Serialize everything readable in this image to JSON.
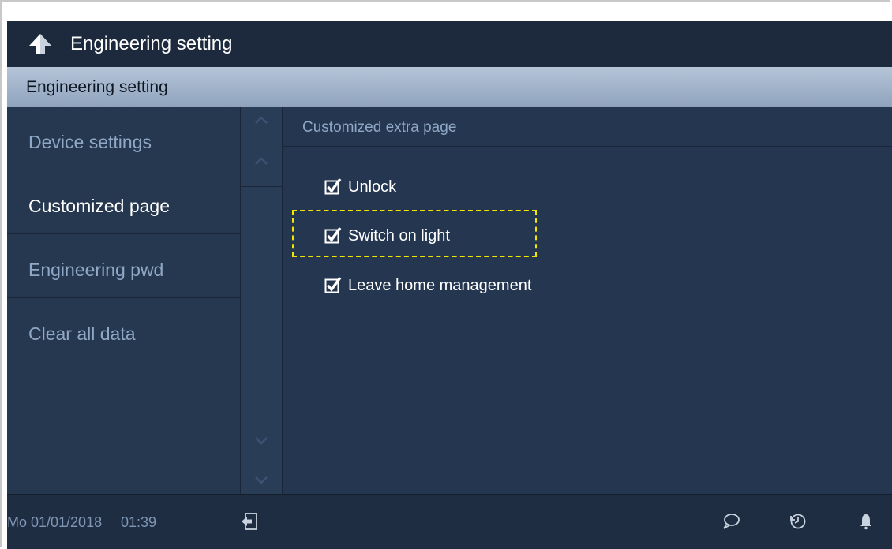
{
  "titlebar": {
    "title": "Engineering setting",
    "back_icon": "back-arrow-icon"
  },
  "subheader": {
    "title": "Engineering setting"
  },
  "sidebar": {
    "items": [
      {
        "label": "Device settings",
        "active": false
      },
      {
        "label": "Customized page",
        "active": true
      },
      {
        "label": "Engineering pwd",
        "active": false
      },
      {
        "label": "Clear all data",
        "active": false
      }
    ]
  },
  "content": {
    "heading": "Customized extra page",
    "options": [
      {
        "label": "Unlock",
        "checked": true
      },
      {
        "label": "Switch on light",
        "checked": true
      },
      {
        "label": "Leave home management",
        "checked": true
      }
    ]
  },
  "footer": {
    "date": "Mo 01/01/2018",
    "time": "01:39",
    "icons": [
      "exit-icon",
      "message-icon",
      "history-icon",
      "bell-icon"
    ]
  },
  "colors": {
    "titlebar_bg": "#1d2a3d",
    "panel_bg": "#253650",
    "highlight": "#f2e600",
    "inactive_text": "#8fa8c6"
  }
}
